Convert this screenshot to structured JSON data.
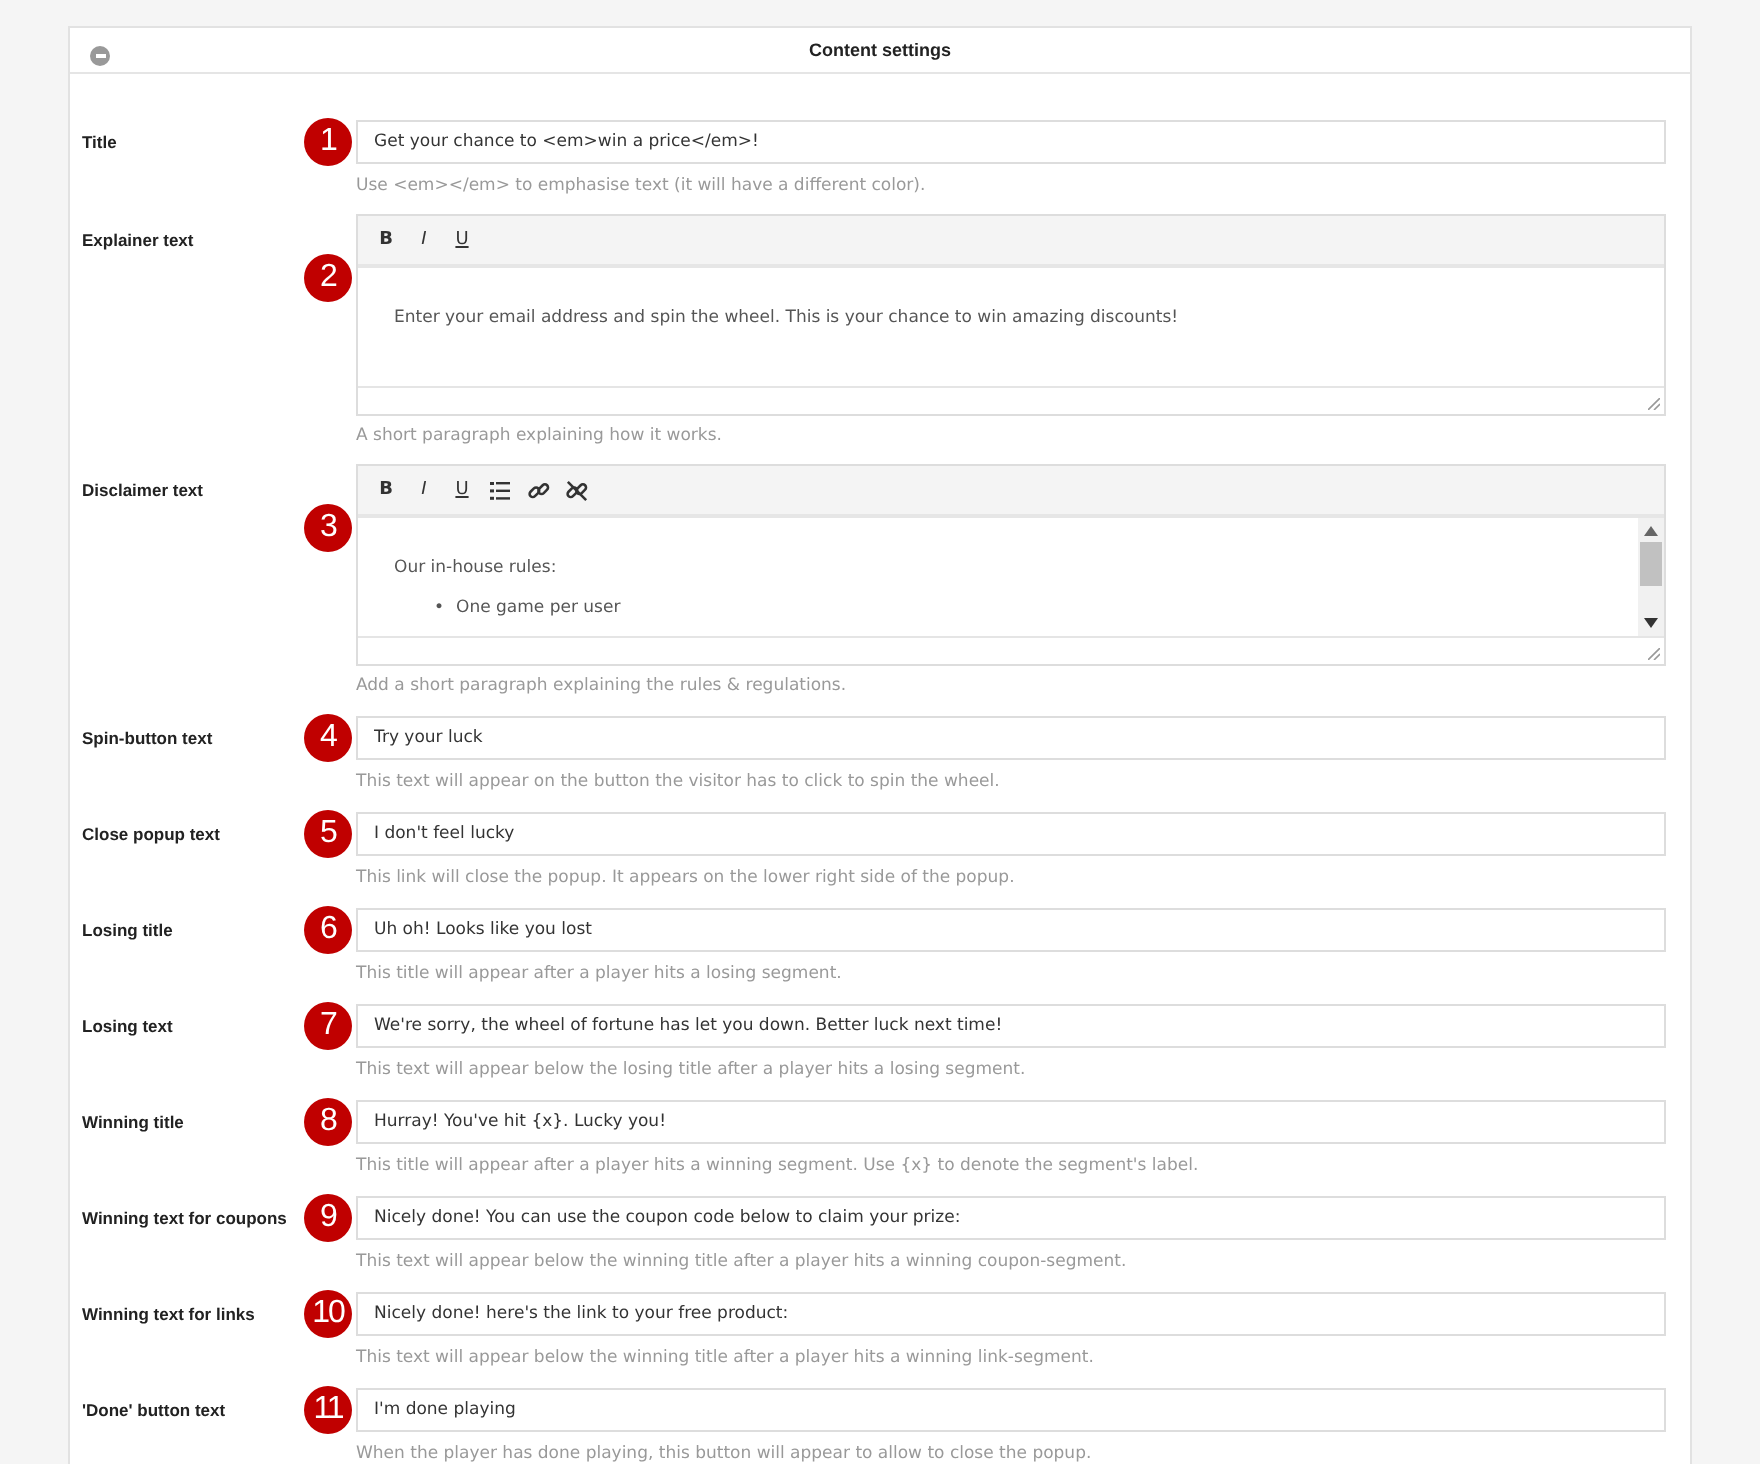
{
  "panel": {
    "title": "Content settings"
  },
  "fields": [
    {
      "kind": "input",
      "label": "Title",
      "badge": "1",
      "value": "Get your chance to <em>win a price</em>!",
      "hint": "Use <em></em> to emphasise text (it will have a different color)."
    },
    {
      "kind": "editor",
      "label": "Explainer text",
      "badge": "2",
      "toolbar": [
        {
          "kind": "bold",
          "text": "B"
        },
        {
          "kind": "italic",
          "text": "I"
        },
        {
          "kind": "underline",
          "text": "U"
        }
      ],
      "paragraphs": [
        "Enter your email address and spin the wheel. This is your chance to win amazing discounts!"
      ],
      "hint": "A short paragraph explaining how it works."
    },
    {
      "kind": "editor",
      "label": "Disclaimer text",
      "badge": "3",
      "toolbar": [
        {
          "kind": "bold",
          "text": "B"
        },
        {
          "kind": "italic",
          "text": "I"
        },
        {
          "kind": "underline",
          "text": "U"
        },
        {
          "kind": "list"
        },
        {
          "kind": "link"
        },
        {
          "kind": "unlink"
        }
      ],
      "paragraphs": [
        "Our in-house rules:"
      ],
      "bullets": [
        {
          "marker": "•",
          "text": "One game per user"
        }
      ],
      "scrollbar": true,
      "hint": "Add a short paragraph explaining the rules & regulations."
    },
    {
      "kind": "input",
      "label": "Spin-button text",
      "badge": "4",
      "value": "Try your luck",
      "hint": "This text will appear on the button the visitor has to click to spin the wheel."
    },
    {
      "kind": "input",
      "label": "Close popup text",
      "badge": "5",
      "value": "I don't feel lucky",
      "hint": "This link will close the popup. It appears on the lower right side of the popup."
    },
    {
      "kind": "input",
      "label": "Losing title",
      "badge": "6",
      "value": "Uh oh! Looks like you lost",
      "hint": "This title will appear after a player hits a losing segment."
    },
    {
      "kind": "input",
      "label": "Losing text",
      "badge": "7",
      "value": "We're sorry, the wheel of fortune has let you down. Better luck next time!",
      "hint": "This text will appear below the losing title after a player hits a losing segment."
    },
    {
      "kind": "input",
      "label": "Winning title",
      "badge": "8",
      "value": "Hurray! You've hit {x}. Lucky you!",
      "hint": "This title will appear after a player hits a winning segment. Use {x} to denote the segment's label."
    },
    {
      "kind": "input",
      "label": "Winning text for coupons",
      "badge": "9",
      "value": "Nicely done! You can use the coupon code below to claim your prize:",
      "hint": "This text will appear below the winning title after a player hits a winning coupon-segment."
    },
    {
      "kind": "input",
      "label": "Winning text for links",
      "badge": "10",
      "value": "Nicely done! here's the link to your free product:",
      "hint": "This text will appear below the winning title after a player hits a winning link-segment."
    },
    {
      "kind": "input",
      "label": "'Done' button text",
      "badge": "11",
      "value": "I'm done playing",
      "hint": "When the player has done playing, this button will appear to allow to close the popup."
    }
  ]
}
